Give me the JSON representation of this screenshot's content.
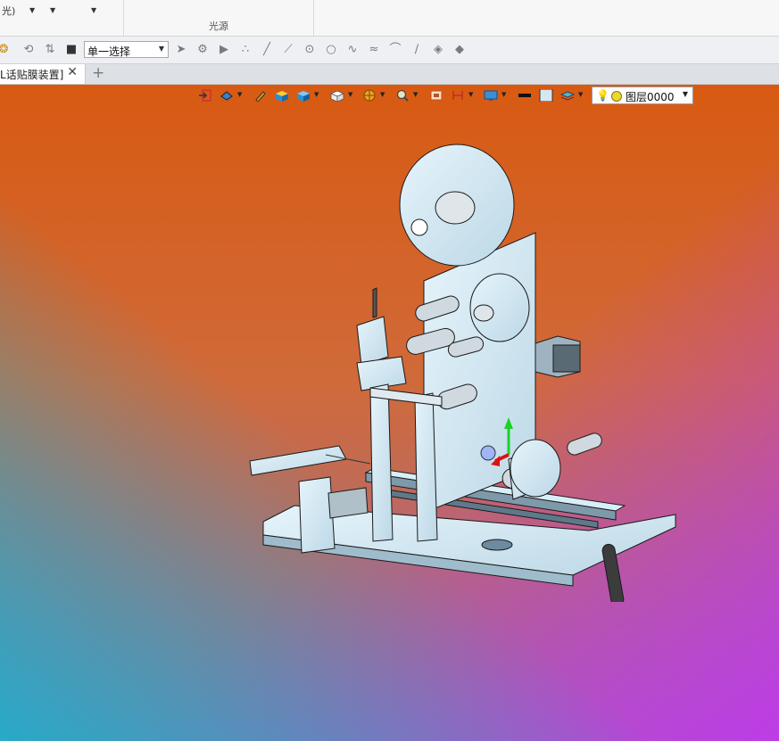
{
  "ribbon": {
    "group1_text": "光)",
    "group2_label": "光源"
  },
  "filter_toolbar": {
    "selection_mode": "单一选择",
    "icons": [
      "filter-icon",
      "rotate-icon",
      "flip-icon",
      "stop-icon",
      "cursor-icon",
      "gear-icon",
      "play-icon",
      "points-icon",
      "line-icon",
      "diagonal-icon",
      "circle-center-icon",
      "circle-icon",
      "curve-icon",
      "wave-icon",
      "arc-icon",
      "pen-icon",
      "surface-icon",
      "solid-icon"
    ]
  },
  "tabs": [
    {
      "label": "L话贴膜装置]",
      "close": "✕"
    }
  ],
  "tab_add": "+",
  "viewport": {
    "toolbar_icons": [
      "exit-icon",
      "view-orient-icon",
      "pen-tool-icon",
      "box-color-icon",
      "cube-icon",
      "white-cube-icon",
      "sphere-icon",
      "zoom-icon",
      "fit-icon",
      "section-icon",
      "display-icon",
      "black-bar-icon",
      "square-icon",
      "layer-stack-icon"
    ],
    "layer": "图层0000",
    "colors": {
      "top": "#d85a12",
      "bottom_left": "#28aac8",
      "bottom_right": "#be3ce6"
    }
  }
}
